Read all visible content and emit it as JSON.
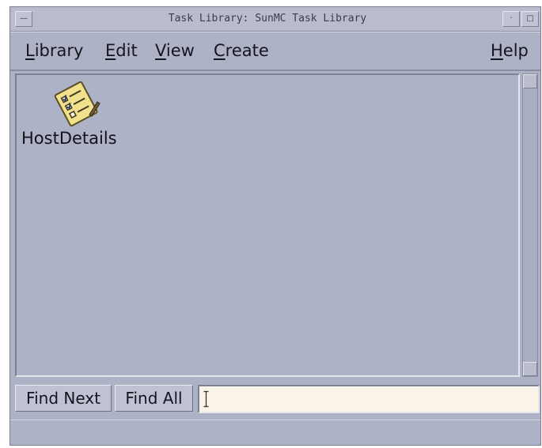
{
  "window": {
    "title": "Task Library: SunMC Task Library"
  },
  "menubar": {
    "items": [
      {
        "mnemonic": "L",
        "rest": "ibrary"
      },
      {
        "mnemonic": "E",
        "rest": "dit"
      },
      {
        "mnemonic": "V",
        "rest": "iew"
      },
      {
        "mnemonic": "C",
        "rest": "reate"
      }
    ],
    "help": {
      "mnemonic": "H",
      "rest": "elp"
    }
  },
  "tasks": [
    {
      "label": "HostDetails",
      "icon": "task-checklist-icon"
    }
  ],
  "find": {
    "next_label": "Find Next",
    "all_label": "Find All",
    "value": ""
  },
  "colors": {
    "window_bg": "#aeb2c6",
    "input_bg": "#faf3e8"
  }
}
